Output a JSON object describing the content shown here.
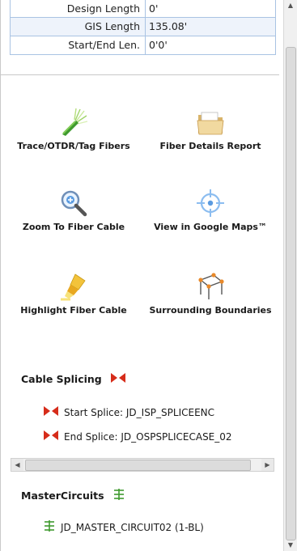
{
  "properties": [
    {
      "key": "Design Length",
      "value": "0'"
    },
    {
      "key": "GIS Length",
      "value": "135.08'"
    },
    {
      "key": "Start/End Len.",
      "value": "0'0'"
    }
  ],
  "tools": [
    {
      "label": "Trace/OTDR/Tag Fibers",
      "icon": "fiber-bundle-icon"
    },
    {
      "label": "Fiber Details Report",
      "icon": "folder-icon"
    },
    {
      "label": "Zoom To Fiber Cable",
      "icon": "magnifier-icon"
    },
    {
      "label": "View in Google Maps™",
      "icon": "crosshair-icon"
    },
    {
      "label": "Highlight Fiber Cable",
      "icon": "highlighter-icon"
    },
    {
      "label": "Surrounding Boundaries",
      "icon": "boundary-icon"
    }
  ],
  "cable_splicing": {
    "title": "Cable Splicing",
    "items": [
      {
        "label": "Start Splice: JD_ISP_SPLICEENC"
      },
      {
        "label": "End Splice: JD_OSPSPLICECASE_02"
      }
    ]
  },
  "master_circuits": {
    "title": "MasterCircuits",
    "items": [
      {
        "label": "JD_MASTER_CIRCUIT02 (1-BL)"
      }
    ]
  },
  "colors": {
    "table_border": "#a9c3e3",
    "splice_red": "#d62c1a",
    "circuit_green": "#3f9a2e"
  }
}
